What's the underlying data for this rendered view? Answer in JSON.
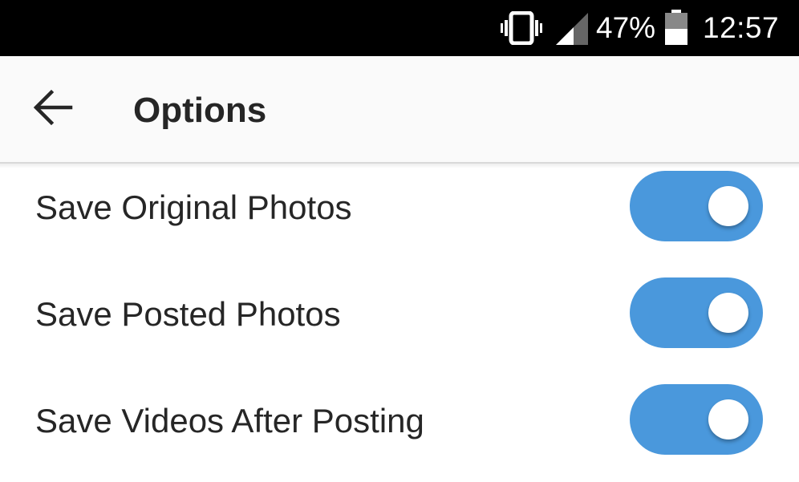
{
  "status_bar": {
    "icons": [
      "vibrate-icon",
      "cell-signal-icon",
      "battery-icon"
    ],
    "battery_percent": "47%",
    "time": "12:57",
    "colors": {
      "background": "#000000",
      "foreground": "#ffffff"
    }
  },
  "app_bar": {
    "back_icon": "arrow-left-icon",
    "title": "Options"
  },
  "options": [
    {
      "label": "Save Original Photos",
      "enabled": true
    },
    {
      "label": "Save Posted Photos",
      "enabled": true
    },
    {
      "label": "Save Videos After Posting",
      "enabled": true
    }
  ],
  "colors": {
    "toggle_on": "#4a98dc",
    "app_bar_bg": "#fafafa",
    "text": "#262626"
  }
}
